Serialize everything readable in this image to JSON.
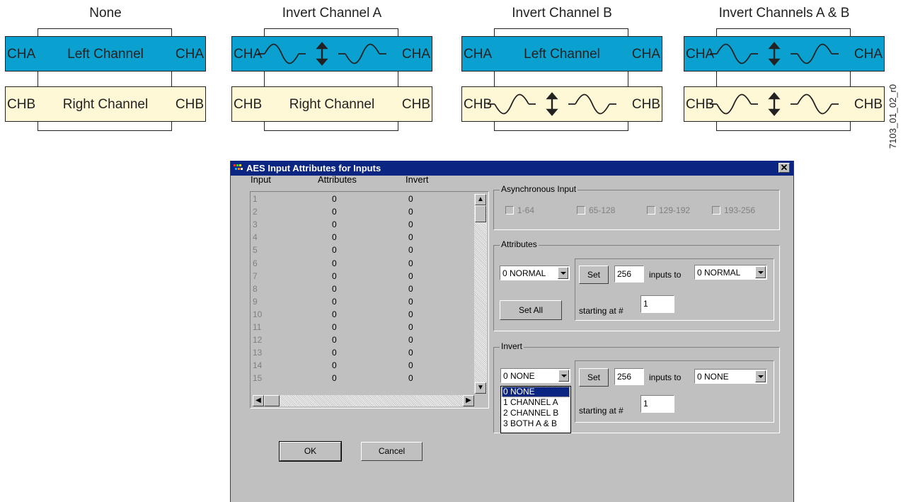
{
  "diagrams": [
    {
      "title": "None",
      "top": {
        "left": "CHA",
        "center": "Left Channel",
        "right": "CHA",
        "mode": "text"
      },
      "bottom": {
        "left": "CHB",
        "center": "Right Channel",
        "right": "CHB",
        "mode": "text"
      }
    },
    {
      "title": "Invert Channel A",
      "top": {
        "left": "CHA",
        "center": "",
        "right": "CHA",
        "mode": "wave"
      },
      "bottom": {
        "left": "CHB",
        "center": "Right Channel",
        "right": "CHB",
        "mode": "text"
      }
    },
    {
      "title": "Invert Channel B",
      "top": {
        "left": "CHA",
        "center": "Left Channel",
        "right": "CHA",
        "mode": "text"
      },
      "bottom": {
        "left": "CHB",
        "center": "",
        "right": "CHB",
        "mode": "wave"
      }
    },
    {
      "title": "Invert Channels A & B",
      "top": {
        "left": "CHA",
        "center": "",
        "right": "CHA",
        "mode": "wave"
      },
      "bottom": {
        "left": "CHB",
        "center": "",
        "right": "CHB",
        "mode": "wave"
      }
    }
  ],
  "colors": {
    "cha_bar": "#0aa1d0",
    "chb_bar": "#fff8d6",
    "titlebar": "#0b2582",
    "dialog_bg": "#c0c0c0"
  },
  "figure_id": "7103_01_02_r0",
  "dialog": {
    "title": "AES Input Attributes for Inputs",
    "close_icon": "close-icon",
    "columns": {
      "input": "Input",
      "attributes": "Attributes",
      "invert": "Invert"
    },
    "rows": [
      {
        "input": "1",
        "attributes": "0",
        "invert": "0"
      },
      {
        "input": "2",
        "attributes": "0",
        "invert": "0"
      },
      {
        "input": "3",
        "attributes": "0",
        "invert": "0"
      },
      {
        "input": "4",
        "attributes": "0",
        "invert": "0"
      },
      {
        "input": "5",
        "attributes": "0",
        "invert": "0"
      },
      {
        "input": "6",
        "attributes": "0",
        "invert": "0"
      },
      {
        "input": "7",
        "attributes": "0",
        "invert": "0"
      },
      {
        "input": "8",
        "attributes": "0",
        "invert": "0"
      },
      {
        "input": "9",
        "attributes": "0",
        "invert": "0"
      },
      {
        "input": "10",
        "attributes": "0",
        "invert": "0"
      },
      {
        "input": "11",
        "attributes": "0",
        "invert": "0"
      },
      {
        "input": "12",
        "attributes": "0",
        "invert": "0"
      },
      {
        "input": "13",
        "attributes": "0",
        "invert": "0"
      },
      {
        "input": "14",
        "attributes": "0",
        "invert": "0"
      },
      {
        "input": "15",
        "attributes": "0",
        "invert": "0"
      }
    ],
    "async": {
      "label": "Asynchronous Input",
      "options": [
        "1-64",
        "65-128",
        "129-192",
        "193-256"
      ]
    },
    "attributes": {
      "label": "Attributes",
      "select": "0 NORMAL",
      "set": "Set",
      "count": "256",
      "inputs_to": "inputs to",
      "target": "0 NORMAL",
      "starting_at": "starting at #",
      "start": "1",
      "set_all": "Set All"
    },
    "invert": {
      "label": "Invert",
      "select": "0 NONE",
      "set": "Set",
      "count": "256",
      "inputs_to": "inputs to",
      "target": "0 NONE",
      "starting_at": "starting at #",
      "start": "1",
      "options": [
        "0 NONE",
        "1 CHANNEL A",
        "2 CHANNEL B",
        "3 BOTH A & B"
      ],
      "selected": "0 NONE"
    },
    "ok": "OK",
    "cancel": "Cancel"
  }
}
